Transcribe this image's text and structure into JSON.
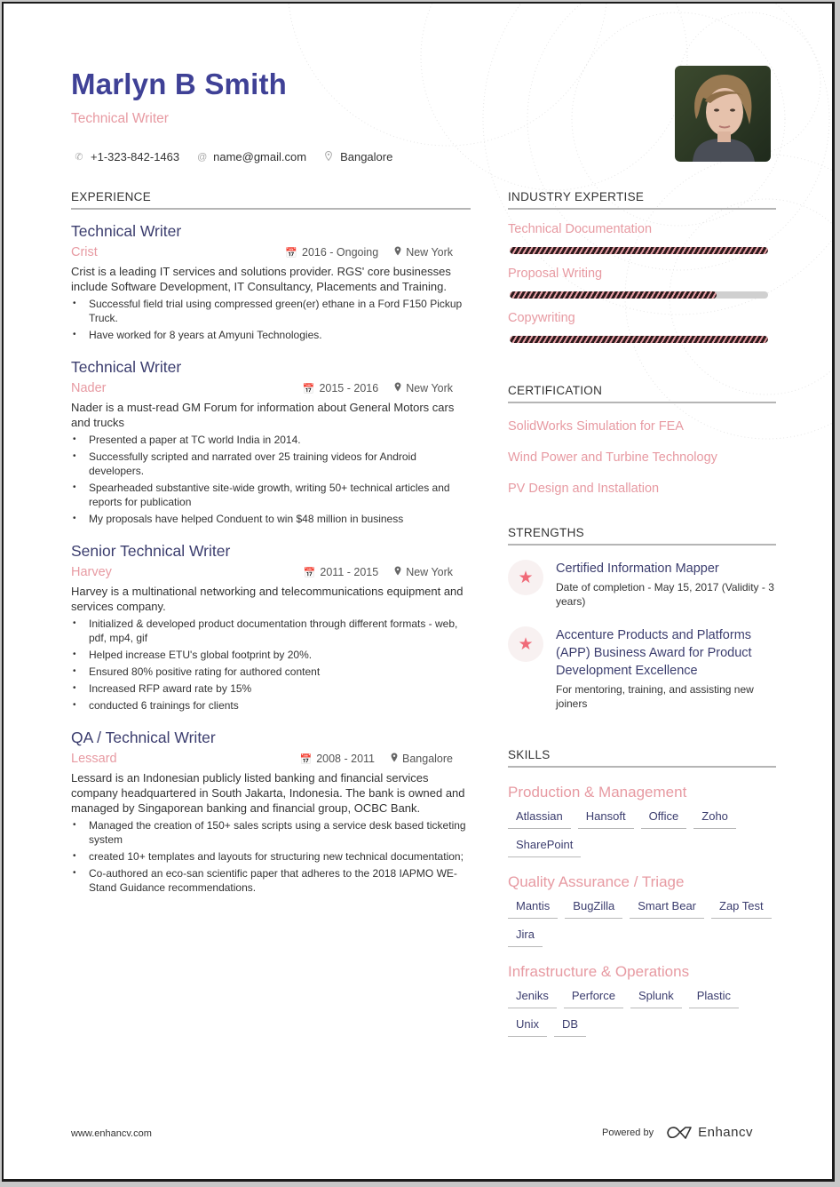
{
  "header": {
    "name": "Marlyn B Smith",
    "role": "Technical Writer",
    "contacts": [
      {
        "icon": "phone-icon",
        "value": "+1-323-842-1463"
      },
      {
        "icon": "at-icon",
        "value": "name@gmail.com"
      },
      {
        "icon": "location-pin-icon",
        "value": "Bangalore"
      }
    ],
    "photo_alt": "Profile photo"
  },
  "experience": {
    "heading": "EXPERIENCE",
    "jobs": [
      {
        "title": "Technical Writer",
        "company": "Crist",
        "dates": "2016 - Ongoing",
        "location": "New York",
        "description": "Crist is a leading IT services and solutions provider. RGS' core businesses include Software Development, IT Consultancy, Placements and Training.",
        "bullets": [
          "Successful field trial using compressed green(er) ethane in a Ford F150 Pickup Truck.",
          "Have worked for 8 years at Amyuni Technologies."
        ]
      },
      {
        "title": "Technical Writer",
        "company": "Nader",
        "dates": "2015 - 2016",
        "location": "New York",
        "description": "Nader is a must-read GM Forum for information about General Motors cars and trucks",
        "bullets": [
          "Presented a paper at TC world India in 2014.",
          "Successfully scripted and narrated over 25 training videos for Android developers.",
          "Spearheaded substantive site-wide growth, writing 50+ technical articles and reports for publication",
          "My proposals have helped Conduent to win $48 million in business"
        ]
      },
      {
        "title": "Senior Technical Writer",
        "company": "Harvey",
        "dates": "2011 - 2015",
        "location": "New York",
        "description": "Harvey is a multinational networking and telecommunications equipment and services company.",
        "bullets": [
          "Initialized & developed product documentation through different formats - web, pdf, mp4, gif",
          "Helped increase ETU's global footprint by 20%.",
          "Ensured 80% positive rating for authored content",
          "Increased RFP award rate by 15%",
          "conducted 6 trainings for clients"
        ]
      },
      {
        "title": "QA / Technical Writer",
        "company": "Lessard",
        "dates": "2008 - 2011",
        "location": "Bangalore",
        "description": "Lessard is an Indonesian publicly listed banking and financial services company headquartered in South Jakarta, Indonesia. The bank is owned and managed by Singaporean banking and financial group, OCBC Bank.",
        "bullets": [
          "Managed the creation of 150+ sales scripts using a service desk based ticketing system",
          "created 10+ templates and layouts for structuring new technical documentation;",
          "Co-authored an eco-san scientific paper that adheres to the 2018 IAPMO WE-Stand Guidance recommendations."
        ]
      }
    ]
  },
  "expertise": {
    "heading": "INDUSTRY EXPERTISE",
    "items": [
      {
        "label": "Technical Documentation",
        "level": 1.0
      },
      {
        "label": "Proposal Writing",
        "level": 0.8
      },
      {
        "label": "Copywriting",
        "level": 1.0
      }
    ]
  },
  "certification": {
    "heading": "CERTIFICATION",
    "items": [
      "SolidWorks Simulation for FEA",
      "Wind Power and Turbine Technology",
      "PV Design and Installation"
    ]
  },
  "strengths": {
    "heading": "STRENGTHS",
    "items": [
      {
        "title": "Certified Information Mapper",
        "description": "Date of completion - May 15, 2017 (Validity - 3 years)"
      },
      {
        "title": "Accenture Products and Platforms (APP) Business Award for Product Development Excellence",
        "description": "For mentoring, training, and assisting new joiners"
      }
    ]
  },
  "skills": {
    "heading": "SKILLS",
    "groups": [
      {
        "title": "Production & Management",
        "tags": [
          "Atlassian",
          "Hansoft",
          "Office",
          "Zoho",
          "SharePoint"
        ]
      },
      {
        "title": "Quality Assurance / Triage",
        "tags": [
          "Mantis",
          "BugZilla",
          "Smart Bear",
          "Zap Test",
          "Jira"
        ]
      },
      {
        "title": "Infrastructure & Operations",
        "tags": [
          "Jeniks",
          "Perforce",
          "Splunk",
          "Plastic",
          "Unix",
          "DB"
        ]
      }
    ]
  },
  "footer": {
    "website": "www.enhancv.com",
    "powered_by": "Powered by",
    "brand": "Enhancv"
  },
  "colors": {
    "name": "#3f4196",
    "accent_pink": "#e79aa2",
    "star": "#f06a78",
    "title_dark": "#3b3d6e"
  }
}
